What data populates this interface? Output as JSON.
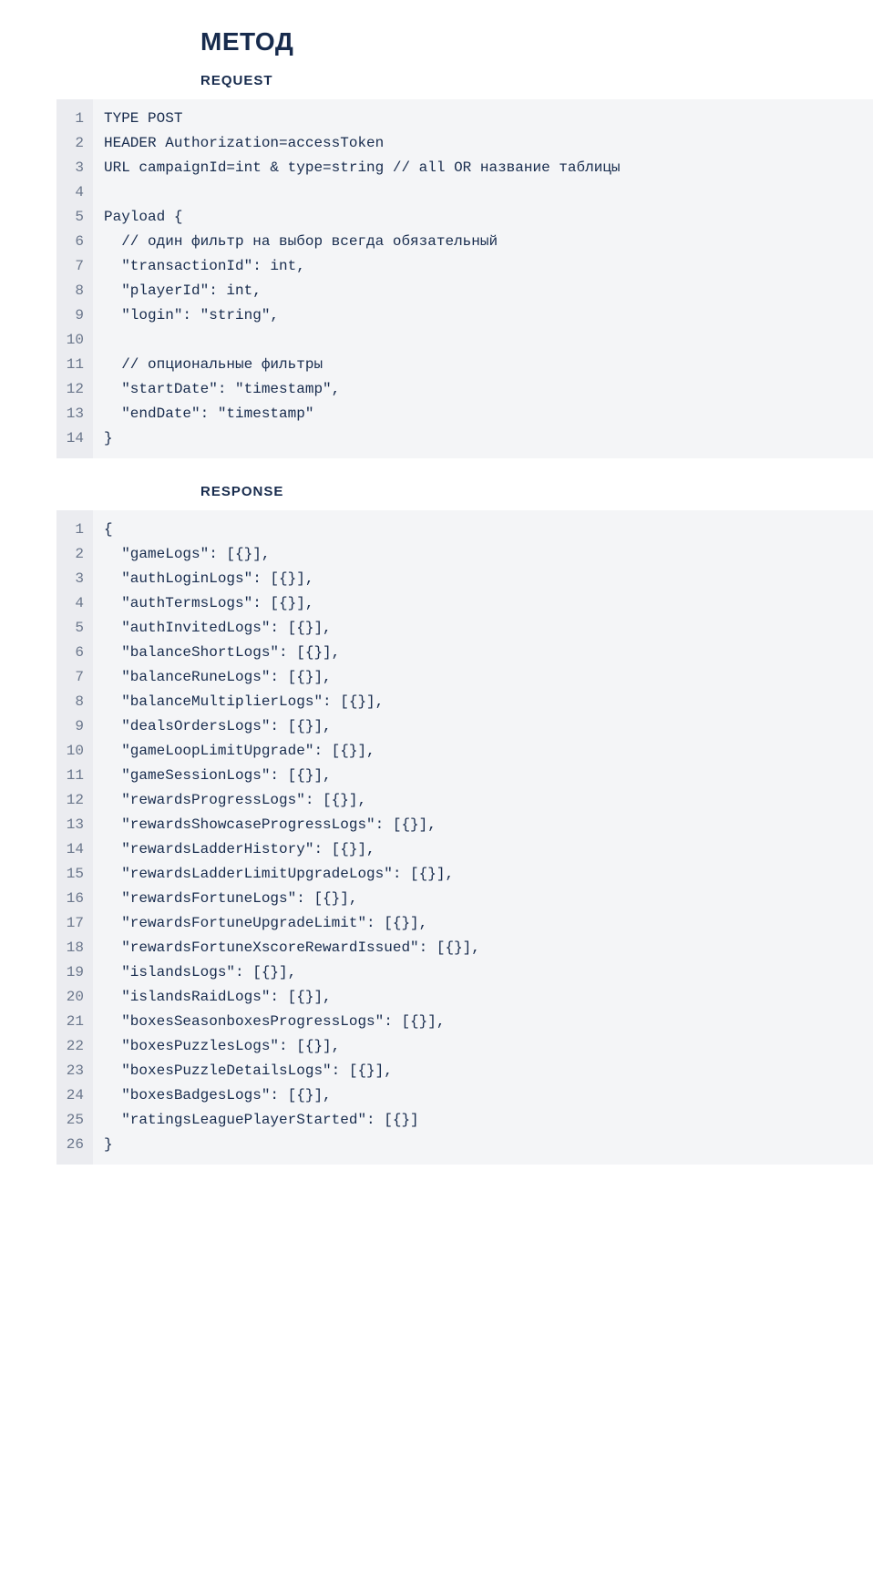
{
  "title": "МЕТОД",
  "request": {
    "label": "REQUEST",
    "lines": [
      "TYPE POST",
      "HEADER Authorization=accessToken",
      "URL campaignId=int & type=string // all OR название таблицы",
      "",
      "Payload {",
      "  // один фильтр на выбор всегда обязательный",
      "  \"transactionId\": int,",
      "  \"playerId\": int,",
      "  \"login\": \"string\",",
      "",
      "  // опциональные фильтры",
      "  \"startDate\": \"timestamp\",",
      "  \"endDate\": \"timestamp\"",
      "}"
    ]
  },
  "response": {
    "label": "RESPONSE",
    "lines": [
      "{",
      "  \"gameLogs\": [{}],",
      "  \"authLoginLogs\": [{}],",
      "  \"authTermsLogs\": [{}],",
      "  \"authInvitedLogs\": [{}],",
      "  \"balanceShortLogs\": [{}],",
      "  \"balanceRuneLogs\": [{}],",
      "  \"balanceMultiplierLogs\": [{}],",
      "  \"dealsOrdersLogs\": [{}],",
      "  \"gameLoopLimitUpgrade\": [{}],",
      "  \"gameSessionLogs\": [{}],",
      "  \"rewardsProgressLogs\": [{}],",
      "  \"rewardsShowcaseProgressLogs\": [{}],",
      "  \"rewardsLadderHistory\": [{}],",
      "  \"rewardsLadderLimitUpgradeLogs\": [{}],",
      "  \"rewardsFortuneLogs\": [{}],",
      "  \"rewardsFortuneUpgradeLimit\": [{}],",
      "  \"rewardsFortuneXscoreRewardIssued\": [{}],",
      "  \"islandsLogs\": [{}],",
      "  \"islandsRaidLogs\": [{}],",
      "  \"boxesSeasonboxesProgressLogs\": [{}],",
      "  \"boxesPuzzlesLogs\": [{}],",
      "  \"boxesPuzzleDetailsLogs\": [{}],",
      "  \"boxesBadgesLogs\": [{}],",
      "  \"ratingsLeaguePlayerStarted\": [{}]",
      "}"
    ]
  }
}
